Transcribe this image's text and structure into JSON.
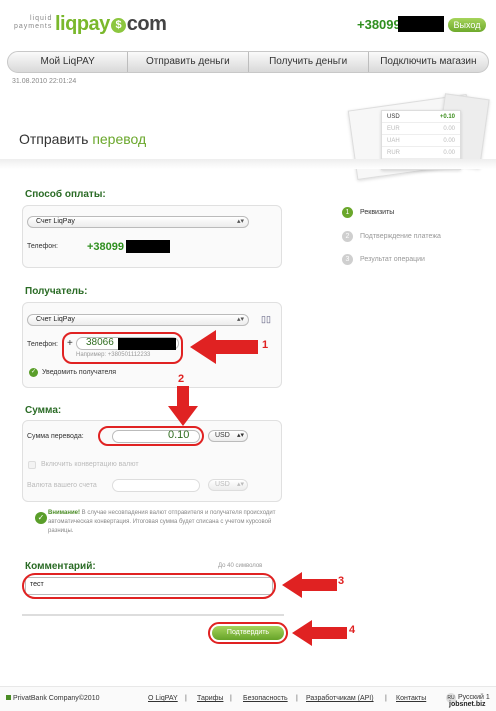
{
  "header": {
    "logo_tag_line1": "liquid",
    "logo_tag_line2": "payments",
    "logo_part1": "liqpay",
    "logo_coin": "$",
    "logo_part2": "com",
    "phone_prefix": "+38099",
    "logout_label": "Выход"
  },
  "menu": {
    "items": [
      "Мой LiqPAY",
      "Отправить деньги",
      "Получить деньги",
      "Подключить магазин"
    ]
  },
  "datetime": "31.08.2010 22:01:24",
  "rates": [
    {
      "currency": "USD",
      "value": "+0.10"
    },
    {
      "currency": "EUR",
      "value": "0.00"
    },
    {
      "currency": "UAH",
      "value": "0.00"
    },
    {
      "currency": "RUR",
      "value": "0.00"
    }
  ],
  "page_title": {
    "part1": "Отправить",
    "part2": "перевод"
  },
  "payment": {
    "title": "Способ оплаты:",
    "method": "Счет LiqPay",
    "phone_label": "Телефон:",
    "phone_prefix": "+38099"
  },
  "recipient": {
    "title": "Получатель:",
    "method": "Счет LiqPay",
    "phone_label": "Телефон:",
    "plus": "+",
    "phone_value": "38066",
    "phone_hint": "Например: +380501112233",
    "notify_label": "Уведомить получателя"
  },
  "amount": {
    "title": "Сумма:",
    "label": "Сумма перевода:",
    "value": "0.10",
    "currency": "USD",
    "conversion_label": "Включить конвертацию валют",
    "account_currency_label": "Валюта вашего счета",
    "account_currency": "USD"
  },
  "warning": {
    "bold": "Внимание!",
    "text": " В случае несовпадения валют отправителя и получателя происходит автоматическая конвертация. Итоговая сумма будет списана с учетом курсовой разницы."
  },
  "comment": {
    "title": "Комментарий:",
    "limit": "До 40 символов",
    "value": "тест"
  },
  "submit_label": "Подтвердить",
  "steps": [
    {
      "num": "1",
      "label": "Реквизиты"
    },
    {
      "num": "2",
      "label": "Подтверждение платежа"
    },
    {
      "num": "3",
      "label": "Результат операции"
    }
  ],
  "annotations": [
    "1",
    "2",
    "3",
    "4"
  ],
  "footer": {
    "copyright": "PrivatBank Company©2010",
    "links": [
      "О LiqPAY",
      "Тарифы",
      "Безопасность",
      "Разработчикам (API)",
      "Контакты"
    ],
    "separator": "|",
    "lang_code": "RU",
    "lang_label": "Русский 1"
  },
  "watermark": "jobsnet.biz",
  "colors": {
    "accent": "#6aa72b",
    "annotation": "#e02222"
  }
}
